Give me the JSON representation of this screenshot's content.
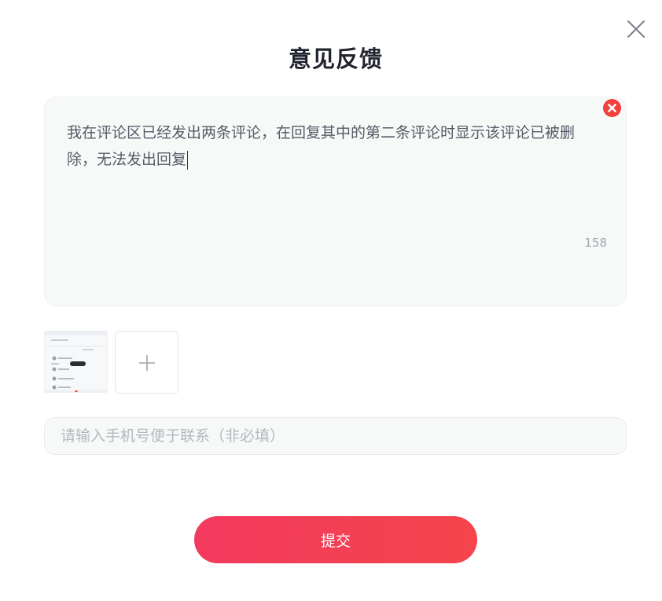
{
  "dialog": {
    "title": "意见反馈",
    "close_icon": "close-icon"
  },
  "feedback": {
    "text": "我在评论区已经发出两条评论，在回复其中的第二条评论时显示该评论已被删除，无法发出回复",
    "char_count": "158",
    "clear_icon": "clear-circle-icon",
    "clear_color": "#f0413d"
  },
  "attachments": {
    "add_icon": "plus-icon"
  },
  "contact": {
    "placeholder": "请输入手机号便于联系（非必填）",
    "value": ""
  },
  "actions": {
    "submit_label": "提交",
    "submit_colors": [
      "#f4395e",
      "#f5444b"
    ]
  }
}
